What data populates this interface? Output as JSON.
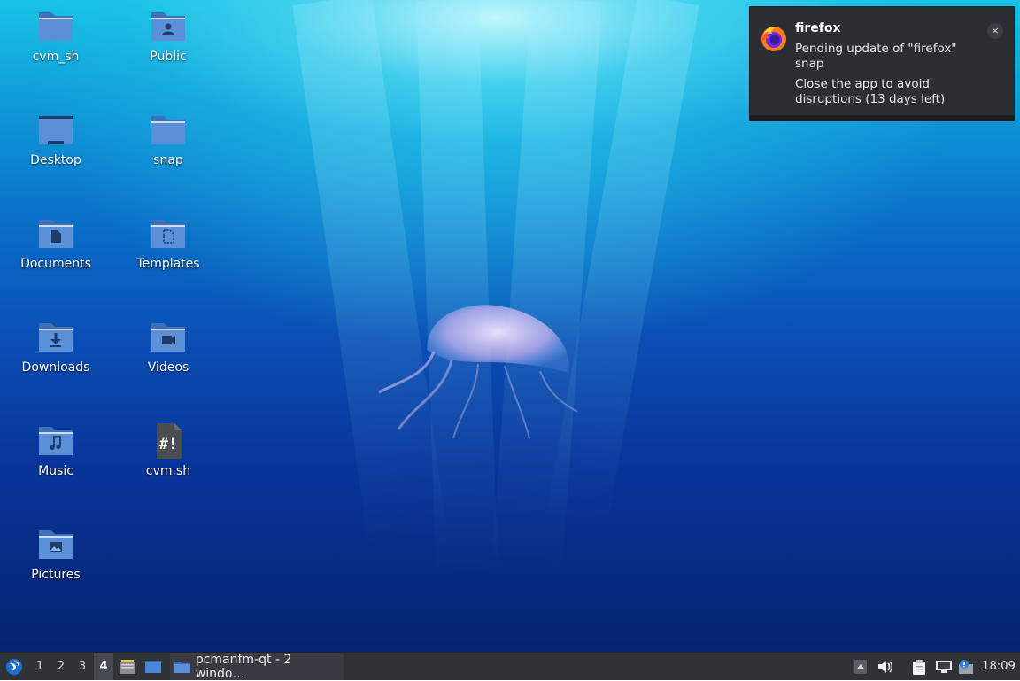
{
  "desktop": {
    "icons": [
      {
        "label": "cvm_sh",
        "icon": "folder-icon"
      },
      {
        "label": "Public",
        "icon": "folder-public-icon"
      },
      {
        "label": "Desktop",
        "icon": "folder-desktop-icon"
      },
      {
        "label": "snap",
        "icon": "folder-icon"
      },
      {
        "label": "Documents",
        "icon": "folder-documents-icon"
      },
      {
        "label": "Templates",
        "icon": "folder-templates-icon"
      },
      {
        "label": "Downloads",
        "icon": "folder-downloads-icon"
      },
      {
        "label": "Videos",
        "icon": "folder-videos-icon"
      },
      {
        "label": "Music",
        "icon": "folder-music-icon"
      },
      {
        "label": "cvm.sh",
        "icon": "shell-script-icon"
      },
      {
        "label": "Pictures",
        "icon": "folder-pictures-icon"
      }
    ]
  },
  "notification": {
    "app": "firefox",
    "line1": "Pending update of \"firefox\" snap",
    "line2": "Close the app to avoid disruptions (13 days left)",
    "close_symbol": "×",
    "icon": "firefox-icon"
  },
  "taskbar": {
    "start_icon": "lubuntu-menu-icon",
    "workspaces": [
      "1",
      "2",
      "3",
      "4"
    ],
    "active_workspace": "4",
    "quicklaunch": [
      "file-manager-icon",
      "show-desktop-icon"
    ],
    "task_label": "pcmanfm-qt - 2 windo…",
    "tray": [
      "tray-expand-icon",
      "volume-icon",
      "clipboard-icon",
      "network-icon",
      "update-notifier-icon"
    ],
    "clock": "18:09"
  },
  "colors": {
    "folder": "#5b8fd8",
    "folder_dark": "#3f6fb8",
    "panel": "#2f3237",
    "notification_bg": "#2b2e33"
  }
}
